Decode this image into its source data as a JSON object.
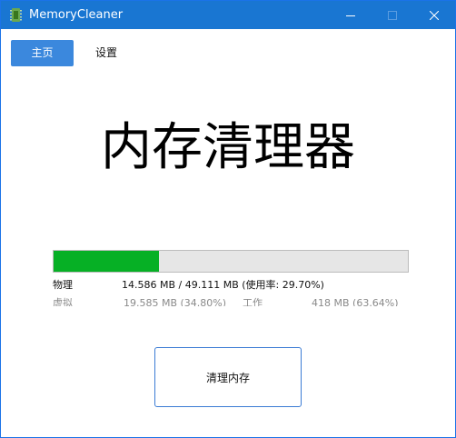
{
  "window": {
    "title": "MemoryCleaner",
    "titlebar_color": "#1976d2"
  },
  "icons": {
    "app": "memory-chip-icon",
    "minimize": "minimize-icon",
    "maximize": "maximize-icon",
    "close": "close-icon"
  },
  "nav": {
    "home_label": "主页",
    "settings_label": "设置",
    "active": "主页",
    "active_color": "#3b88dd"
  },
  "hero": {
    "title": "内存清理器"
  },
  "memory": {
    "usage_fraction": 0.297,
    "fill_color": "#06b025",
    "physical": {
      "label": "物理",
      "value": "14.586 MB / 49.111 MB (使用率: 29.70%)"
    },
    "virtual": {
      "label": "虚拟",
      "value": "19.585 MB (34.80%)"
    },
    "working": {
      "label": "工作",
      "value": "418 MB (63.64%)"
    }
  },
  "actions": {
    "clean_label": "清理内存"
  }
}
